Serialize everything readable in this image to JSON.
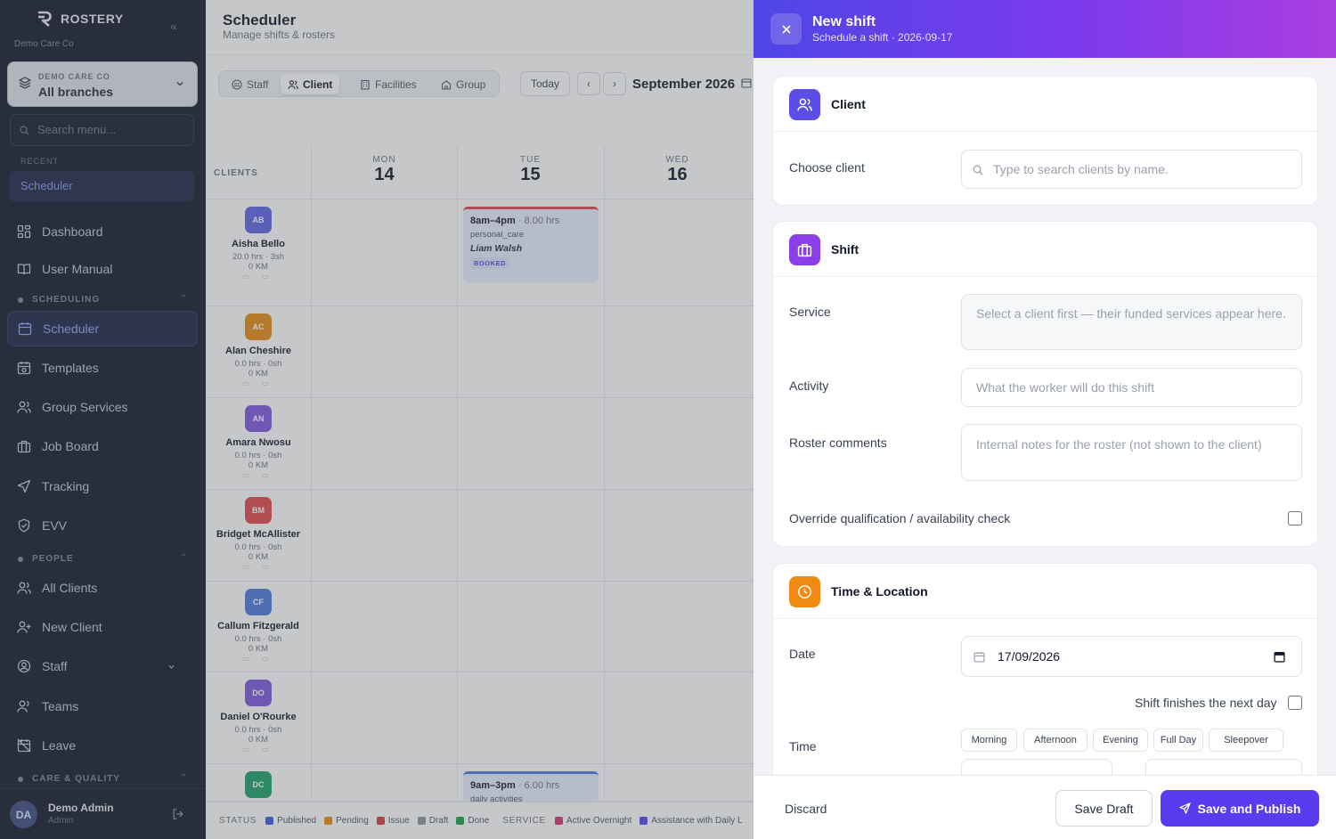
{
  "brand": {
    "name": "ROSTERY",
    "org": "Demo Care Co"
  },
  "branch_selector": {
    "caption": "DEMO CARE CO",
    "value": "All branches"
  },
  "side_search": {
    "placeholder": "Search menu..."
  },
  "recent": {
    "caption": "RECENT",
    "item": "Scheduler"
  },
  "nav": {
    "dashboard": "Dashboard",
    "user_manual": "User Manual",
    "scheduling_section": "SCHEDULING",
    "scheduler": "Scheduler",
    "templates": "Templates",
    "group_services": "Group Services",
    "job_board": "Job Board",
    "tracking": "Tracking",
    "evv": "EVV",
    "people_section": "PEOPLE",
    "all_clients": "All Clients",
    "new_client": "New Client",
    "staff": "Staff",
    "teams": "Teams",
    "leave": "Leave",
    "care_section": "CARE & QUALITY"
  },
  "user": {
    "initials": "DA",
    "name": "Demo Admin",
    "role": "Admin"
  },
  "scheduler": {
    "title": "Scheduler",
    "subtitle": "Manage shifts & rosters",
    "tabs": [
      "Staff",
      "Client",
      "Facilities",
      "Group"
    ],
    "active_tab": "Client",
    "today": "Today",
    "prev": "‹",
    "next": "›",
    "month": "September 2026",
    "clients_caption": "CLIENTS",
    "days": [
      {
        "name": "MON",
        "num": "14"
      },
      {
        "name": "TUE",
        "num": "15"
      },
      {
        "name": "WED",
        "num": "16"
      }
    ],
    "clients": [
      {
        "initials": "AB",
        "name": "Aisha Bello",
        "meta": "20.0 hrs · 3sh",
        "km": "0 KM",
        "color": "#5b63e6"
      },
      {
        "initials": "AC",
        "name": "Alan Cheshire",
        "meta": "0.0 hrs · 0sh",
        "km": "0 KM",
        "color": "#e58a12"
      },
      {
        "initials": "AN",
        "name": "Amara Nwosu",
        "meta": "0.0 hrs · 0sh",
        "km": "0 KM",
        "color": "#7b55e0"
      },
      {
        "initials": "BM",
        "name": "Bridget McAllister",
        "meta": "0.0 hrs · 0sh",
        "km": "0 KM",
        "color": "#e0484a"
      },
      {
        "initials": "CF",
        "name": "Callum Fitzgerald",
        "meta": "0.0 hrs · 0sh",
        "km": "0 KM",
        "color": "#4a7ae0"
      },
      {
        "initials": "DO",
        "name": "Daniel O'Rourke",
        "meta": "0.0 hrs · 0sh",
        "km": "0 KM",
        "color": "#7b55e0"
      },
      {
        "initials": "DC",
        "name": "",
        "meta": "",
        "km": "",
        "color": "#17a06a"
      }
    ],
    "shift1": {
      "time": "8am–4pm",
      "hours": "· 8.00 hrs",
      "service": "personal_care",
      "worker": "Liam Walsh",
      "status": "BOOKED",
      "accent": "#e0484a"
    },
    "shift2": {
      "time": "9am–3pm",
      "hours": "· 6.00 hrs",
      "service": "daily activities",
      "accent": "#4a7ae0"
    },
    "legend": {
      "status_caption": "STATUS",
      "status": [
        {
          "label": "Published",
          "color": "#3b5bdb"
        },
        {
          "label": "Pending",
          "color": "#e58a12"
        },
        {
          "label": "Issue",
          "color": "#d93a3a"
        },
        {
          "label": "Draft",
          "color": "#8a93a3"
        },
        {
          "label": "Done",
          "color": "#16a34a"
        }
      ],
      "service_caption": "SERVICE",
      "service": [
        {
          "label": "Active Overnight",
          "color": "#d6336c"
        },
        {
          "label": "Assistance with Daily L",
          "color": "#4f46e5"
        }
      ]
    }
  },
  "drawer": {
    "title": "New shift",
    "subtitle": "Schedule a shift · 2026-09-17",
    "client_card": {
      "title": "Client",
      "label": "Choose client",
      "placeholder": "Type to search clients by name."
    },
    "shift_card": {
      "title": "Shift",
      "service_label": "Service",
      "service_placeholder": "Select a client first — their funded services appear here.",
      "activity_label": "Activity",
      "activity_placeholder": "What the worker will do this shift",
      "comments_label": "Roster comments",
      "comments_placeholder": "Internal notes for the roster (not shown to the client)",
      "override_label": "Override qualification / availability check"
    },
    "time_card": {
      "title": "Time & Location",
      "date_label": "Date",
      "date_value": "17/09/2026",
      "next_day_label": "Shift finishes the next day",
      "time_label": "Time",
      "presets": [
        "Morning",
        "Afternoon",
        "Evening",
        "Full Day",
        "Sleepover"
      ]
    },
    "footer": {
      "discard": "Discard",
      "save_draft": "Save Draft",
      "publish": "Save and Publish"
    }
  },
  "colors": {
    "accent": "#5a3bf0",
    "header_start": "#4f46e5",
    "header_end": "#a93ee0",
    "client_icon": "#5b4ee8",
    "shift_icon": "#8b3fe6",
    "time_icon": "#f08a12"
  }
}
